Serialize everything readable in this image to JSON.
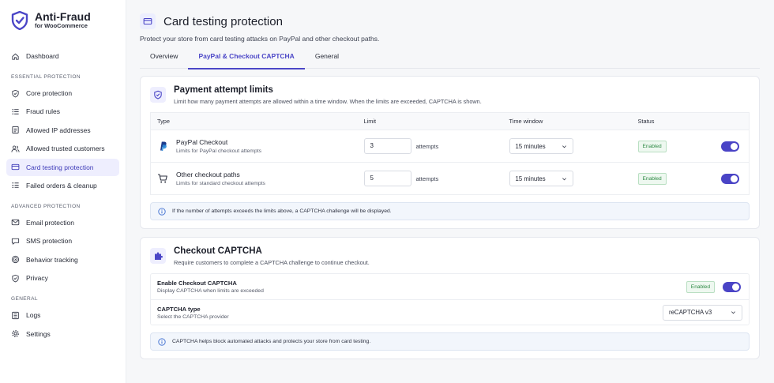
{
  "brand": {
    "name": "Anti-Fraud",
    "subtitle": "for WooCommerce"
  },
  "sidebar": {
    "dashboard": "Dashboard",
    "sections": {
      "essential": "ESSENTIAL PROTECTION",
      "advanced": "ADVANCED PROTECTION",
      "general": "GENERAL"
    },
    "essential_items": [
      "Core protection",
      "Fraud rules",
      "Allowed IP addresses",
      "Allowed trusted customers",
      "Card testing protection",
      "Failed orders & cleanup"
    ],
    "advanced_items": [
      "Email protection",
      "SMS protection",
      "Behavior tracking",
      "Privacy"
    ],
    "general_items": [
      "Logs",
      "Settings"
    ]
  },
  "page": {
    "title": "Card testing protection",
    "subtitle": "Protect your store from card testing attacks on PayPal and other checkout paths.",
    "tabs": [
      "Overview",
      "PayPal & Checkout CAPTCHA",
      "General"
    ]
  },
  "limits_card": {
    "title": "Payment attempt limits",
    "desc": "Limit how many payment attempts are allowed within a time window. When the limits are exceeded, CAPTCHA is shown.",
    "headers": {
      "type": "Type",
      "limit": "Limit",
      "window": "Time window",
      "status": "Status"
    },
    "rows": [
      {
        "name": "PayPal Checkout",
        "desc": "Limits for PayPal checkout attempts",
        "limit": "3",
        "unit": "attempts",
        "window": "15 minutes",
        "status": "Enabled"
      },
      {
        "name": "Other checkout paths",
        "desc": "Limits for standard checkout attempts",
        "limit": "5",
        "unit": "attempts",
        "window": "15 minutes",
        "status": "Enabled"
      }
    ],
    "info": "If the number of attempts exceeds the limits above, a CAPTCHA challenge will be displayed."
  },
  "captcha_card": {
    "title": "Checkout CAPTCHA",
    "desc": "Require customers to complete a CAPTCHA challenge to continue checkout.",
    "enable": {
      "title": "Enable Checkout CAPTCHA",
      "desc": "Display CAPTCHA when limits are exceeded",
      "status": "Enabled"
    },
    "type": {
      "title": "CAPTCHA type",
      "desc": "Select the CAPTCHA provider",
      "value": "reCAPTCHA v3"
    },
    "info": "CAPTCHA helps block automated attacks and protects your store from card testing."
  },
  "colors": {
    "accent": "#4b46c7",
    "enabled_green": "#2f8a45"
  }
}
